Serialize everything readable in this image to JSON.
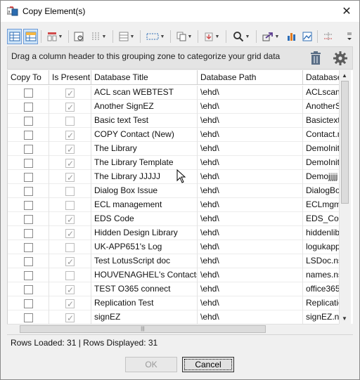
{
  "window": {
    "title": "Copy Element(s)",
    "icon": "copy-element-app-icon"
  },
  "toolbar": {
    "buttons": [
      {
        "name": "grid-layout-icon",
        "active": false
      },
      {
        "name": "group-view-icon",
        "active": true
      },
      {
        "name": "column-chooser-icon",
        "dropdown": true
      },
      {
        "name": "filter-builder-icon"
      },
      {
        "name": "columns-icon",
        "dropdown": true
      },
      {
        "name": "row-height-icon",
        "dropdown": true
      },
      {
        "name": "selection-icon",
        "dropdown": true
      },
      {
        "name": "copy-icon",
        "dropdown": true
      },
      {
        "name": "paste-icon",
        "dropdown": true
      },
      {
        "name": "search-icon",
        "dropdown": true
      },
      {
        "name": "export-icon",
        "dropdown": true
      },
      {
        "name": "chart-icon"
      },
      {
        "name": "image-icon"
      },
      {
        "name": "layout-icon"
      }
    ]
  },
  "groupzone": {
    "text": "Drag a column header to this grouping zone to categorize your grid data"
  },
  "grid": {
    "columns": [
      "Copy To",
      "Is Present",
      "Database Title",
      "Database Path",
      "Database"
    ],
    "rows": [
      {
        "copy": false,
        "present": true,
        "title": "ACL scan WEBTEST",
        "path": "\\ehd\\",
        "file": "ACLscan."
      },
      {
        "copy": false,
        "present": true,
        "title": "Another SignEZ",
        "path": "\\ehd\\",
        "file": "AnotherS"
      },
      {
        "copy": false,
        "present": false,
        "title": "Basic text Test",
        "path": "\\ehd\\",
        "file": "Basictext"
      },
      {
        "copy": false,
        "present": true,
        "title": "COPY Contact (New)",
        "path": "\\ehd\\",
        "file": "Contact.n"
      },
      {
        "copy": false,
        "present": true,
        "title": "The Library",
        "path": "\\ehd\\",
        "file": "DemoInit"
      },
      {
        "copy": false,
        "present": true,
        "title": "The Library Template",
        "path": "\\ehd\\",
        "file": "DemoInit"
      },
      {
        "copy": false,
        "present": true,
        "title": "The Library JJJJJ",
        "path": "\\ehd\\",
        "file": "Demojjjjj"
      },
      {
        "copy": false,
        "present": false,
        "title": "Dialog Box Issue",
        "path": "\\ehd\\",
        "file": "DialogBo"
      },
      {
        "copy": false,
        "present": false,
        "title": "ECL management",
        "path": "\\ehd\\",
        "file": "ECLmgm"
      },
      {
        "copy": false,
        "present": true,
        "title": "EDS Code",
        "path": "\\ehd\\",
        "file": "EDS_Cod"
      },
      {
        "copy": false,
        "present": true,
        "title": "Hidden Design Library",
        "path": "\\ehd\\",
        "file": "hiddenlib"
      },
      {
        "copy": false,
        "present": false,
        "title": "UK-APP651's Log",
        "path": "\\ehd\\",
        "file": "logukapp"
      },
      {
        "copy": false,
        "present": true,
        "title": "Test LotusScript doc",
        "path": "\\ehd\\",
        "file": "LSDoc.ns"
      },
      {
        "copy": false,
        "present": false,
        "title": "HOUVENAGHEL's Contacts",
        "path": "\\ehd\\",
        "file": "names.ns"
      },
      {
        "copy": false,
        "present": true,
        "title": "TEST O365 connect",
        "path": "\\ehd\\",
        "file": "office365"
      },
      {
        "copy": false,
        "present": true,
        "title": "Replication Test",
        "path": "\\ehd\\",
        "file": "Replicatio"
      },
      {
        "copy": false,
        "present": true,
        "title": "signEZ",
        "path": "\\ehd\\",
        "file": "signEZ.ns"
      }
    ]
  },
  "status": {
    "text": "Rows Loaded: 31  |  Rows Displayed: 31"
  },
  "buttons": {
    "ok": "OK",
    "cancel": "Cancel"
  }
}
